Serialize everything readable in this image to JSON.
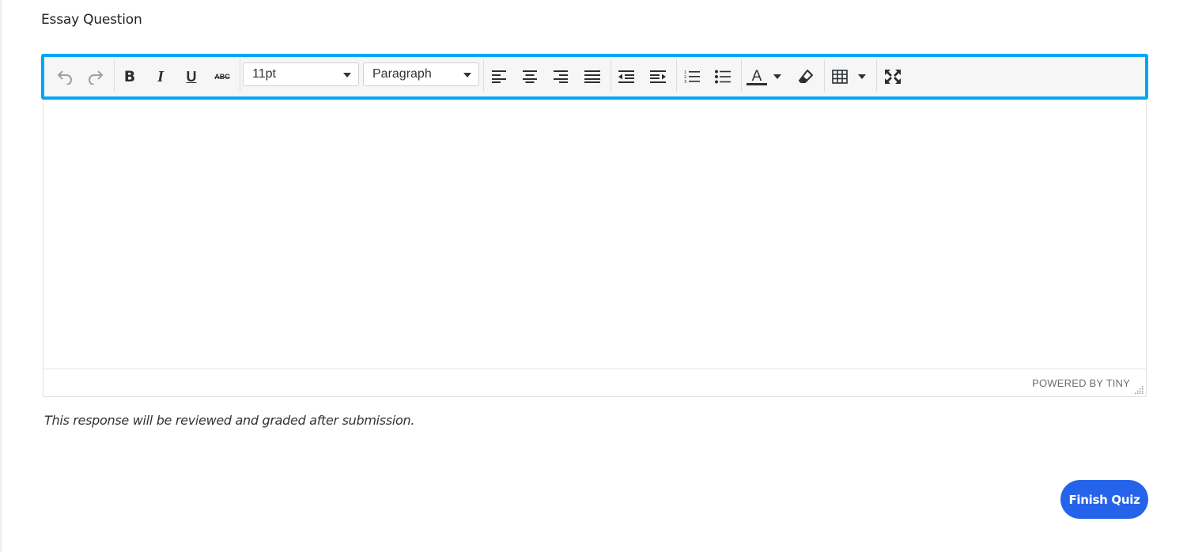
{
  "question": {
    "title": "Essay Question"
  },
  "editor": {
    "font_size_value": "11pt",
    "block_format_value": "Paragraph",
    "powered_by": "POWERED BY TINY",
    "toolbar_icons": [
      "undo-icon",
      "redo-icon",
      "bold-icon",
      "italic-icon",
      "underline-icon",
      "strikethrough-icon",
      "align-left-icon",
      "align-center-icon",
      "align-right-icon",
      "align-justify-icon",
      "outdent-icon",
      "indent-icon",
      "numbered-list-icon",
      "bullet-list-icon",
      "text-color-icon",
      "clear-formatting-icon",
      "table-icon",
      "fullscreen-icon"
    ],
    "accent_color": "#00a6f5"
  },
  "note": {
    "text": "This response will be reviewed and graded after submission."
  },
  "actions": {
    "finish_label": "Finish Quiz",
    "finish_color": "#2563eb"
  }
}
